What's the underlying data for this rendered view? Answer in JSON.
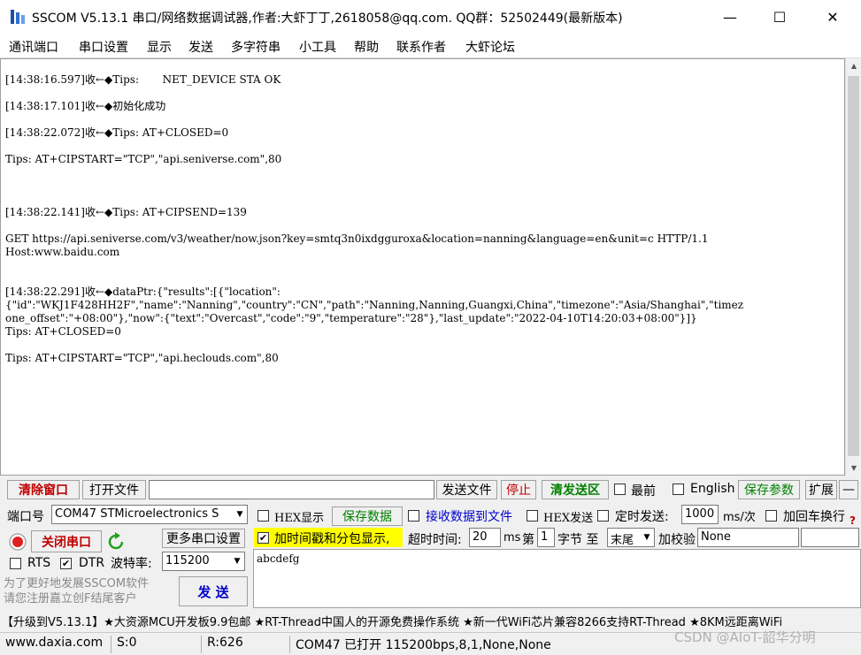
{
  "window": {
    "title": "SSCOM V5.13.1 串口/网络数据调试器,作者:大虾丁丁,2618058@qq.com. QQ群：52502449(最新版本)",
    "min_glyph": "—",
    "max_glyph": "☐",
    "close_glyph": "✕"
  },
  "menu": [
    "通讯端口",
    "串口设置",
    "显示",
    "发送",
    "多字符串",
    "小工具",
    "帮助",
    "联系作者",
    "大虾论坛"
  ],
  "receive_lines": [
    "[14:38:16.597]收←◆Tips:       NET_DEVICE STA OK",
    "[14:38:17.101]收←◆初始化成功",
    "[14:38:22.072]收←◆Tips: AT+CLOSED=0",
    "Tips: AT+CIPSTART=\"TCP\",\"api.seniverse.com\",80",
    "[14:38:22.141]收←◆Tips: AT+CIPSEND=139",
    "GET https://api.seniverse.com/v3/weather/now.json?key=smtq3n0ixdgguroxa&location=nanning&language=en&unit=c HTTP/1.1",
    "Host:www.baidu.com",
    "[14:38:22.291]收←◆dataPtr:{\"results\":[{\"location\":",
    "{\"id\":\"WKJ1F428HH2F\",\"name\":\"Nanning\",\"country\":\"CN\",\"path\":\"Nanning,Nanning,Guangxi,China\",\"timezone\":\"Asia/Shanghai\",\"timez",
    "one_offset\":\"+08:00\"},\"now\":{\"text\":\"Overcast\",\"code\":\"9\",\"temperature\":\"28\"},\"last_update\":\"2022-04-10T14:20:03+08:00\"}]}",
    "Tips: AT+CLOSED=0",
    "Tips: AT+CIPSTART=\"TCP\",\"api.heclouds.com\",80"
  ],
  "toolbar1": {
    "clear_window": "清除窗口",
    "open_file": "打开文件",
    "send_file": "发送文件",
    "stop": "停止",
    "clear_send": "清发送区",
    "topmost": "最前",
    "english": "English",
    "save_params": "保存参数",
    "expand": "扩展",
    "collapse": "—"
  },
  "port": {
    "port_label": "端口号",
    "port_value": "COM47 STMicroelectronics S",
    "close_port": "关闭串口",
    "more_settings": "更多串口设置",
    "rts": "RTS",
    "dtr": "DTR",
    "baud_label": "波特率:",
    "baud_value": "115200",
    "promo": "为了更好地发展SSCOM软件\n请您注册嘉立创F结尾客户",
    "send": "发  送"
  },
  "options": {
    "hex_display": "HEX显示",
    "save_data": "保存数据",
    "recv_to_file": "接收数据到文件",
    "hex_send": "HEX发送",
    "timed_send": "定时发送:",
    "interval": "1000",
    "interval_unit": "ms/次",
    "add_crlf": "加回车换行",
    "timestamp": "加时间戳和分包显示,",
    "timeout_label": "超时时间:",
    "timeout_value": "20",
    "timeout_unit": "ms",
    "byte_label_pre": "第",
    "byte_index": "1",
    "byte_label_mid": "字节 至",
    "byte_end": "末尾",
    "checksum_label": "加校验",
    "checksum_value": "None"
  },
  "send_text": "abcdefg",
  "ad_text": "【升级到V5.13.1】★大资源MCU开发板9.9包邮 ★RT-Thread中国人的开源免费操作系统 ★新一代WiFi芯片兼容8266支持RT-Thread ★8KM远距离WiFi",
  "status": {
    "site": "www.daxia.com",
    "sent": "S:0",
    "recv": "R:626",
    "port_info": "COM47 已打开  115200bps,8,1,None,None"
  },
  "watermark": "CSDN @AIoT-韶华分明",
  "colors": {
    "highlight_yellow": "#ffff00",
    "red_text": "#c00000",
    "green_text": "#008000",
    "blue_link": "#0000cc"
  }
}
